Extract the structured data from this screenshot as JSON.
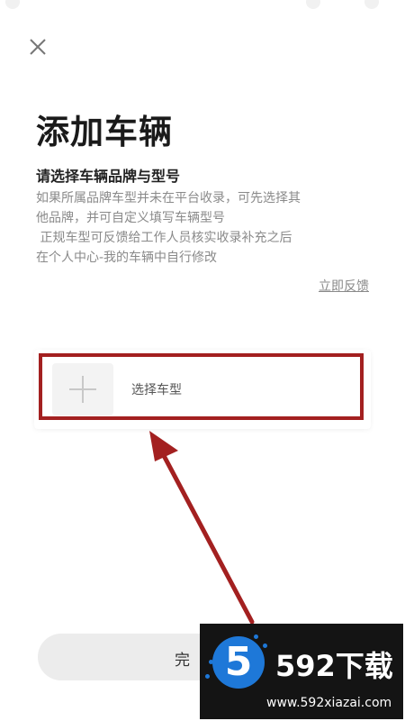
{
  "header": {
    "close_icon": "close-icon"
  },
  "page": {
    "title": "添加车辆",
    "subtitle": "请选择车辆品牌与型号",
    "description_lines": [
      "如果所属品牌车型并未在平台收录，可先选择其",
      "他品牌，并可自定义填写车辆型号",
      " 正规车型可反馈给工作人员核实收录补充之后",
      "在个人中心-我的车辆中自行修改"
    ],
    "feedback_link": "立即反馈"
  },
  "model_selector": {
    "icon": "plus-icon",
    "label": "选择车型"
  },
  "footer": {
    "done_label": "完"
  },
  "watermark": {
    "logo_text": "5",
    "brand": "592下载",
    "url": "www.592xiazai.com"
  },
  "colors": {
    "annotation": "#a32020",
    "background": "#ffffff",
    "muted_text": "#8a8a8a"
  }
}
